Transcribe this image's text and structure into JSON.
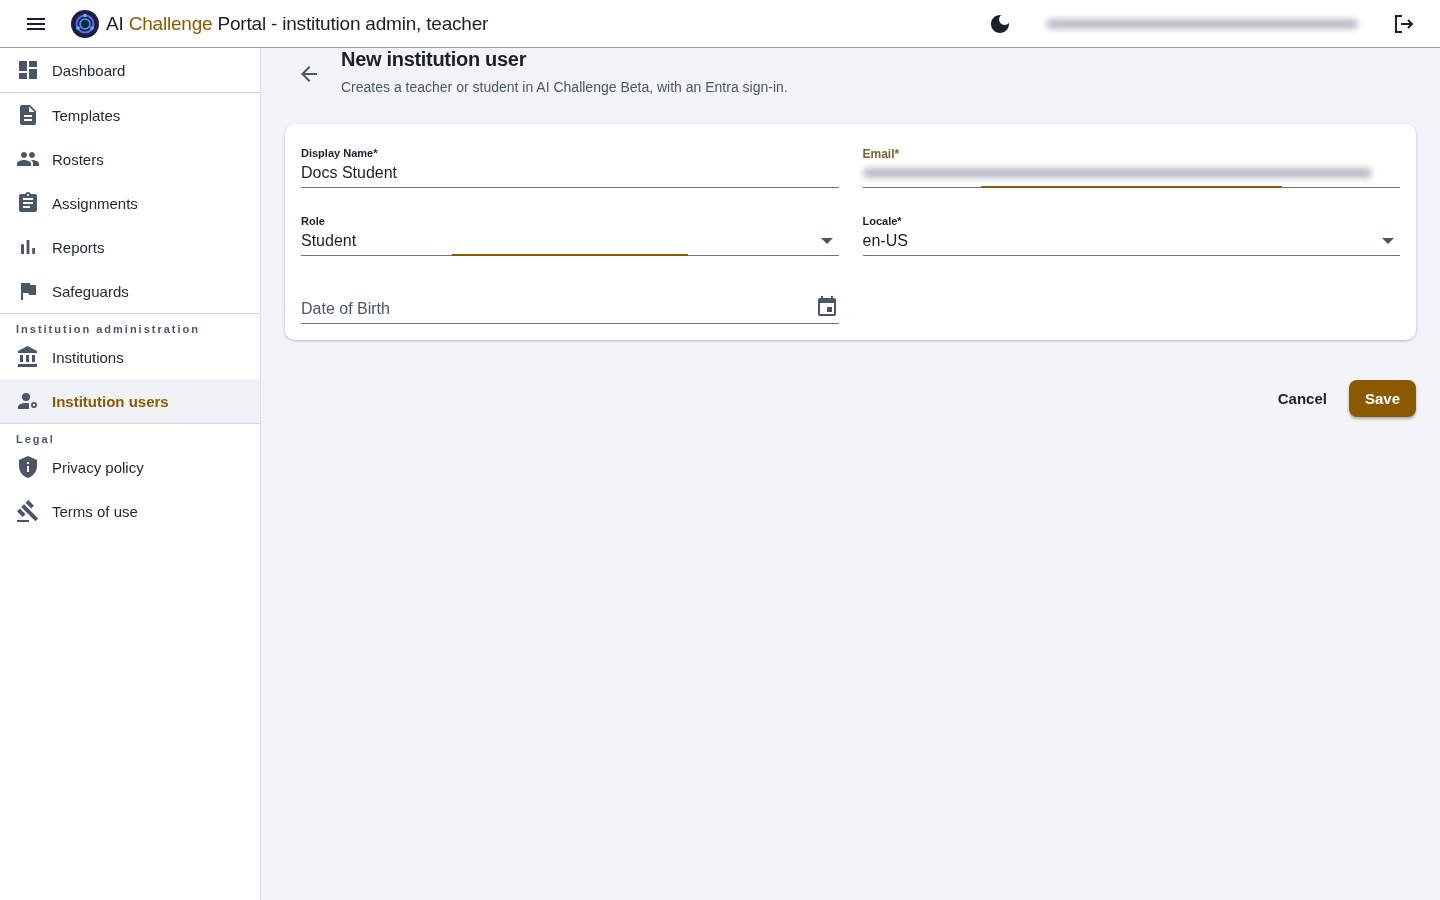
{
  "header": {
    "title_start": "AI",
    "title_accent": "Challenge",
    "title_end": "Portal - institution admin, teacher"
  },
  "sidebar": {
    "groups": [
      {
        "items": [
          {
            "label": "Dashboard",
            "selected": false
          }
        ]
      },
      {
        "items": [
          {
            "label": "Templates",
            "selected": false
          },
          {
            "label": "Rosters",
            "selected": false
          },
          {
            "label": "Assignments",
            "selected": false
          },
          {
            "label": "Reports",
            "selected": false
          },
          {
            "label": "Safeguards",
            "selected": false
          }
        ]
      },
      {
        "heading": "Institution administration",
        "items": [
          {
            "label": "Institutions",
            "selected": false
          },
          {
            "label": "Institution users",
            "selected": true
          }
        ]
      },
      {
        "heading": "Legal",
        "items": [
          {
            "label": "Privacy policy",
            "selected": false
          },
          {
            "label": "Terms of use",
            "selected": false
          }
        ]
      }
    ]
  },
  "page": {
    "title": "New institution user",
    "subtitle": "Creates a teacher or student in AI Challenge Beta, with an Entra sign-in."
  },
  "form": {
    "fields": [
      {
        "kind": "text",
        "label": "Display Name*",
        "value": "Docs Student",
        "focused": false,
        "underline_highlight": false
      },
      {
        "kind": "blurred",
        "label": "Email*",
        "focused": true,
        "underline_highlight": true
      },
      {
        "kind": "select",
        "label": "Role",
        "value": "Student",
        "focused": false,
        "underline_highlight": true
      },
      {
        "kind": "select",
        "label": "Locale*",
        "value": "en-US",
        "focused": false,
        "underline_highlight": false
      },
      {
        "kind": "date",
        "placeholder": "Date of Birth",
        "focused": false,
        "underline_highlight": false
      }
    ]
  },
  "buttons": [
    {
      "label": "Cancel",
      "kind": "text"
    },
    {
      "label": "Save",
      "kind": "primary"
    }
  ]
}
